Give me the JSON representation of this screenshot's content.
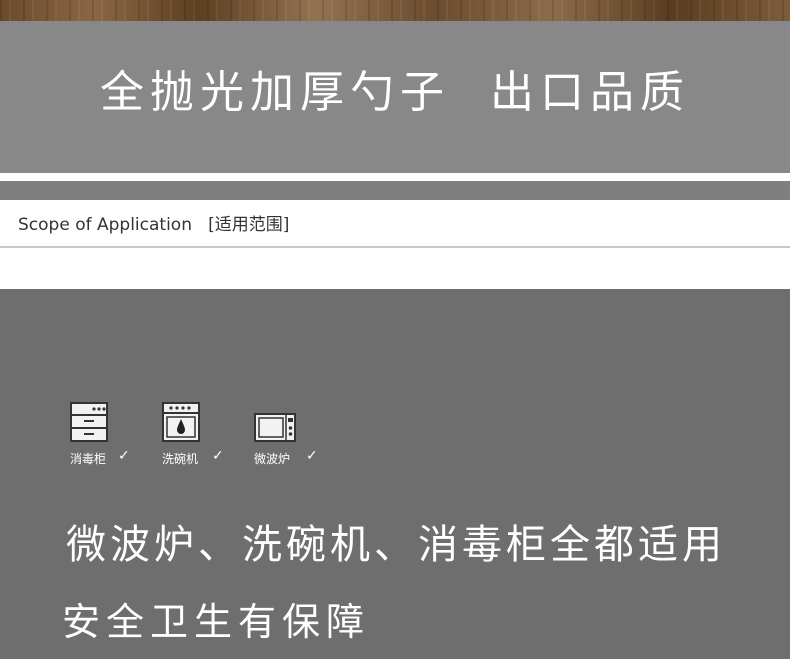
{
  "banner": {
    "title": "全抛光加厚勺子  出口品质"
  },
  "scope": {
    "label": "Scope of Application   [适用范围]"
  },
  "appliances": [
    {
      "label": "消毒柜",
      "icon": "disinfection-cabinet-icon",
      "check": "✓"
    },
    {
      "label": "洗碗机",
      "icon": "dishwasher-icon",
      "check": "✓"
    },
    {
      "label": "微波炉",
      "icon": "microwave-icon",
      "check": "✓"
    }
  ],
  "tagline": {
    "line1": "微波炉、洗碗机、消毒柜全都适用",
    "line2": "安全卫生有保障"
  },
  "colors": {
    "banner_bg": "#888888",
    "panel_bg": "#6e6e6e",
    "text_light": "#ffffff"
  }
}
